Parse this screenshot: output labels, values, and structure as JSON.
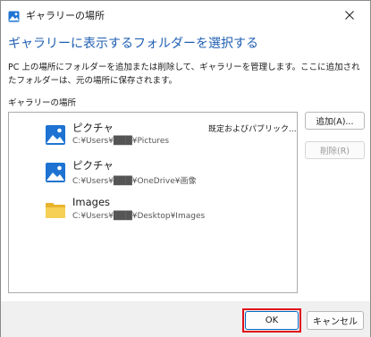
{
  "window": {
    "title": "ギャラリーの場所",
    "icon": "gallery-app-icon",
    "close_icon": "close-icon"
  },
  "heading": "ギャラリーに表示するフォルダーを選択する",
  "description": "PC 上の場所にフォルダーを追加または削除して、ギャラリーを管理します。ここに追加されたフォルダーは、元の場所に保存されます。",
  "list_label": "ギャラリーの場所",
  "locations": [
    {
      "name": "ピクチャ",
      "path": "C:¥Users¥███¥Pictures",
      "status": "既定およびパブリック...",
      "icon": "pictures-folder-icon"
    },
    {
      "name": "ピクチャ",
      "path": "C:¥Users¥███¥OneDrive¥画像",
      "status": "",
      "icon": "pictures-folder-icon"
    },
    {
      "name": "Images",
      "path": "C:¥Users¥███¥Desktop¥Images",
      "status": "",
      "icon": "folder-icon"
    }
  ],
  "buttons": {
    "add": "追加(A)...",
    "remove": "削除(R)",
    "ok": "OK",
    "cancel": "キャンセル"
  },
  "colors": {
    "heading": "#1f5fb3",
    "highlight": "#e0101a",
    "accent": "#0067c0",
    "folder_yellow": "#f3c43f"
  }
}
